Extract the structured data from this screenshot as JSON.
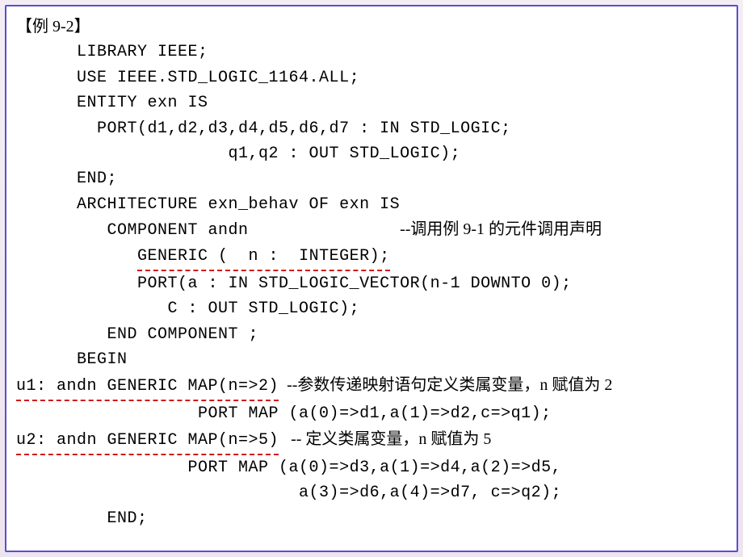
{
  "title": "【例 9-2】",
  "lines": {
    "l1": "      LIBRARY IEEE;",
    "l2": "      USE IEEE.STD_LOGIC_1164.ALL;",
    "l3": "      ENTITY exn IS",
    "l4": "        PORT(d1,d2,d3,d4,d5,d6,d7 : IN STD_LOGIC;",
    "l5": "                     q1,q2 : OUT STD_LOGIC);",
    "l6": "      END;",
    "l7": "      ARCHITECTURE exn_behav OF exn IS",
    "l8a": "         COMPONENT andn               ",
    "l8b": "--调用例 9-1 的元件调用声明",
    "l9a": "            ",
    "l9b": "GENERIC (  n :  INTEGER);",
    "l10": "            PORT(a : IN STD_LOGIC_VECTOR(n-1 DOWNTO 0);",
    "l11": "               C : OUT STD_LOGIC);",
    "l12": "         END COMPONENT ;",
    "l13": "      BEGIN",
    "l14a": "u1: andn GENERIC MAP(n=>2)",
    "l14b": "  --参数传递映射语句定义类属变量，n 赋值为 2",
    "l15": "                  PORT MAP (a(0)=>d1,a(1)=>d2,c=>q1);",
    "l16a": "u2: andn GENERIC MAP(n=>5)",
    "l16b": "   -- 定义类属变量，n 赋值为 5",
    "l17": "                 PORT MAP (a(0)=>d3,a(1)=>d4,a(2)=>d5,",
    "l18": "                            a(3)=>d6,a(4)=>d7, c=>q2);",
    "l19": "         END;"
  }
}
